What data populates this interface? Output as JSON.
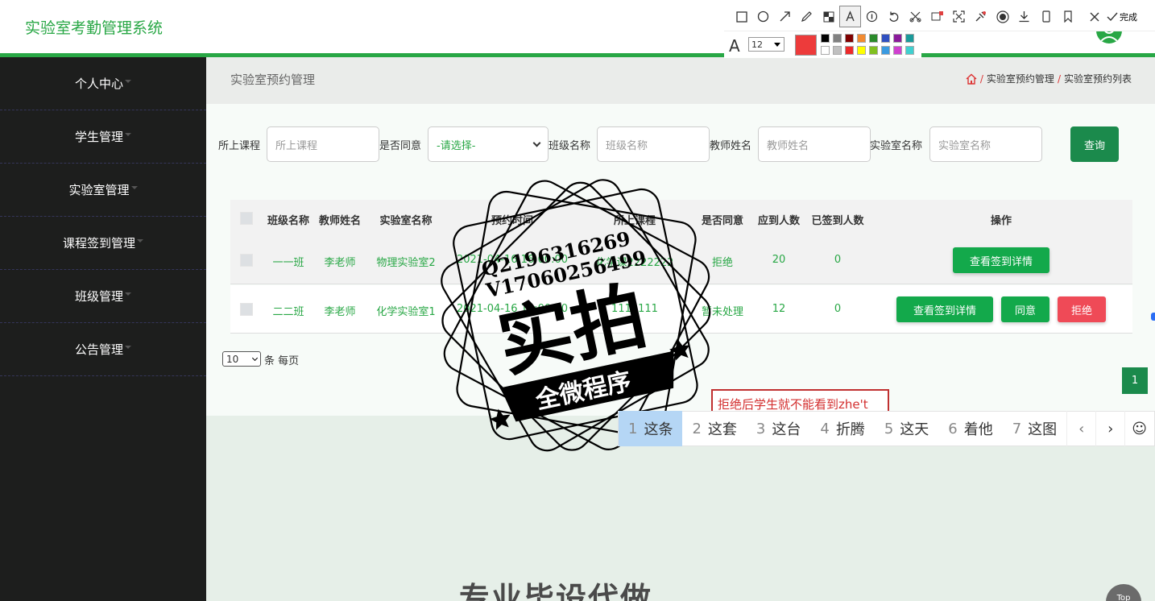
{
  "app": {
    "title": "实验室考勤管理系统"
  },
  "sidebar": {
    "items": [
      {
        "label": "个人中心"
      },
      {
        "label": "学生管理"
      },
      {
        "label": "实验室管理"
      },
      {
        "label": "课程签到管理"
      },
      {
        "label": "班级管理"
      },
      {
        "label": "公告管理"
      }
    ]
  },
  "page": {
    "title": "实验室预约管理",
    "breadcrumb": [
      "实验室预约管理",
      "实验室预约列表"
    ],
    "breadcrumb_sep": "/"
  },
  "search": {
    "course_label": "所上课程",
    "course_placeholder": "所上课程",
    "agree_label": "是否同意",
    "agree_value": "-请选择-",
    "class_label": "班级名称",
    "class_placeholder": "班级名称",
    "teacher_label": "教师姓名",
    "teacher_placeholder": "教师姓名",
    "lab_label": "实验室名称",
    "lab_placeholder": "实验室名称",
    "query_label": "查询"
  },
  "table": {
    "headers": [
      "班级名称",
      "教师姓名",
      "实验室名称",
      "预约时间",
      "所上课程",
      "是否同意",
      "应到人数",
      "已签到人数",
      "操作"
    ],
    "rows": [
      {
        "class": "一一班",
        "teacher": "李老师",
        "lab": "物理实验室2",
        "time": "2021-04-16 16:00:00",
        "course": "化学课2222222",
        "agree": "拒绝",
        "expected": "20",
        "signed": "0",
        "actions": [
          "查看签到详情"
        ]
      },
      {
        "class": "二二班",
        "teacher": "李老师",
        "lab": "化学实验室1",
        "time": "2021-04-16 13:00:00",
        "course": "1111111",
        "agree": "暂未处理",
        "expected": "12",
        "signed": "0",
        "actions": [
          "查看签到详情",
          "同意",
          "拒绝"
        ]
      }
    ]
  },
  "pagination": {
    "page_size": "10",
    "per_page_label": "条 每页",
    "current_page": "1"
  },
  "annotation_toolbar": {
    "done_label": "完成",
    "font_size": "12",
    "current_color": "#ed3b3b",
    "tools": [
      "rectangle-icon",
      "ellipse-icon",
      "arrow-icon",
      "pencil-icon",
      "mosaic-icon",
      "text-icon",
      "number-icon",
      "undo-icon",
      "cut-icon",
      "ocr-icon",
      "expand-icon",
      "pin-icon",
      "record-icon",
      "download-icon",
      "phone-icon",
      "bookmark-icon",
      "close-icon",
      "check-icon"
    ],
    "palette": [
      "#000000",
      "#808080",
      "#800000",
      "#f28a30",
      "#2a8a2a",
      "#2f4fc0",
      "#8a1a9a",
      "#1a9a9a",
      "#ffffff",
      "#c0c0c0",
      "#ed2a2a",
      "#ffff00",
      "#80c020",
      "#3a9ae0",
      "#d040d0",
      "#40d0d0"
    ]
  },
  "annotation_text": "拒绝后学生就不能看到zhe't",
  "ime": {
    "candidates": [
      {
        "num": "1",
        "text": "这条"
      },
      {
        "num": "2",
        "text": "这套"
      },
      {
        "num": "3",
        "text": "这台"
      },
      {
        "num": "4",
        "text": "折腾"
      },
      {
        "num": "5",
        "text": "这天"
      },
      {
        "num": "6",
        "text": "着他"
      },
      {
        "num": "7",
        "text": "这图"
      }
    ]
  },
  "watermark": {
    "line1": "Q2196316269",
    "line2": "V17060256499",
    "main": "实拍",
    "banner": "全微程序"
  },
  "footer": {
    "banner_text": "专业毕设代做",
    "top_button": "Top"
  }
}
